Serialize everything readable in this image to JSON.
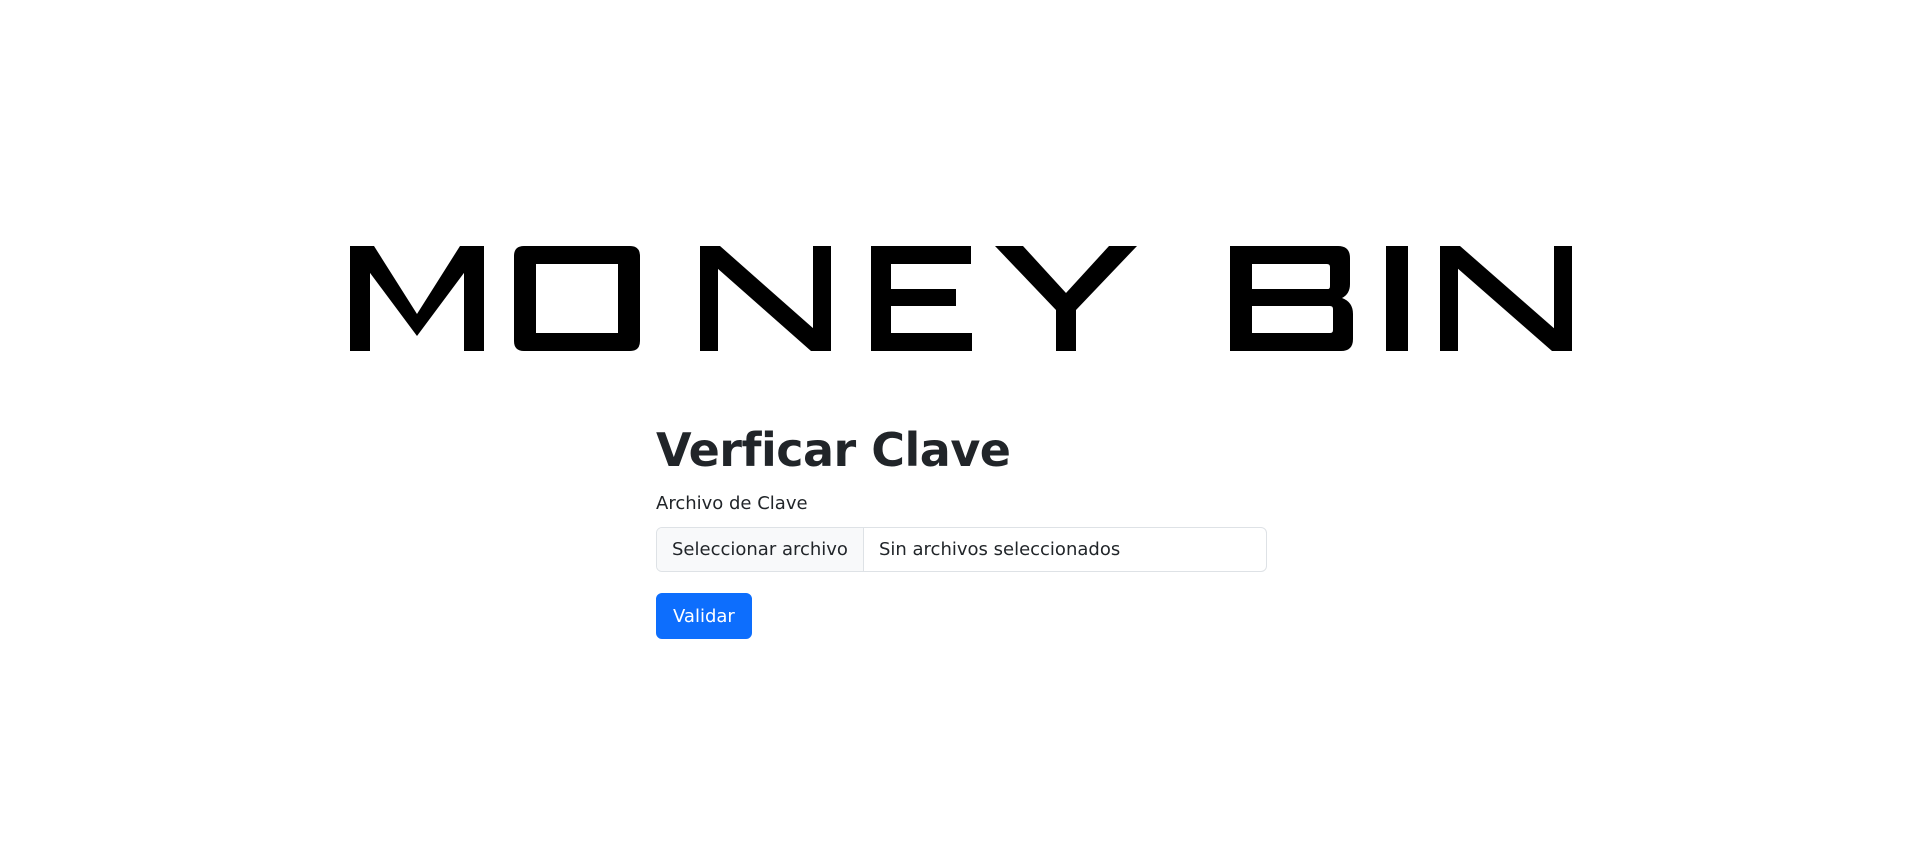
{
  "logo": {
    "text": "MONEY BIN"
  },
  "form": {
    "title": "Verficar Clave",
    "file_label": "Archivo de Clave",
    "file_button_label": "Seleccionar archivo",
    "file_status": "Sin archivos seleccionados",
    "submit_label": "Validar"
  },
  "colors": {
    "primary": "#0d6efd",
    "text": "#212529",
    "border": "#dee2e6",
    "file_button_bg": "#f8f9fa",
    "logo": "#000000"
  }
}
